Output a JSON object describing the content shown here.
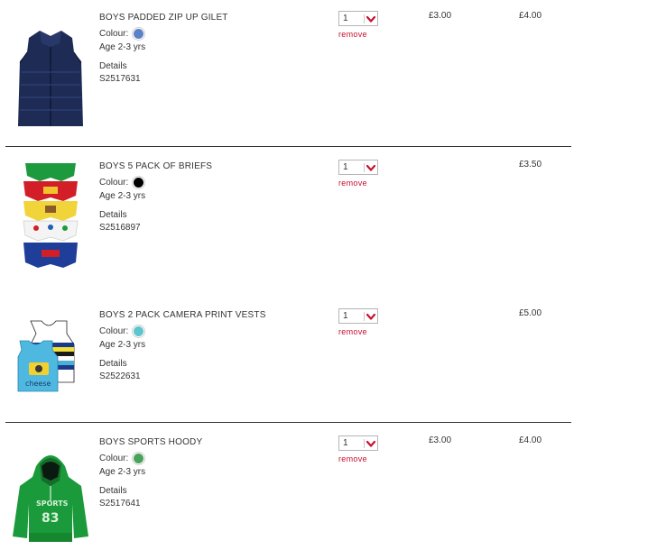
{
  "items": [
    {
      "title": "BOYS PADDED ZIP UP GILET",
      "colour_label": "Colour:",
      "colour_hex": "#5b82c8",
      "size": "Age 2-3 yrs",
      "details_label": "Details",
      "sku": "S2517631",
      "quantity": "1",
      "remove_label": "remove",
      "price_was": "£3.00",
      "price_now": "£4.00",
      "icon": "navy-gilet-icon"
    },
    {
      "title": "BOYS 5 PACK OF BRIEFS",
      "colour_label": "Colour:",
      "colour_hex": "#000000",
      "size": "Age 2-3 yrs",
      "details_label": "Details",
      "sku": "S2516897",
      "quantity": "1",
      "remove_label": "remove",
      "price_was": "",
      "price_now": "£3.50",
      "icon": "briefs-pack-icon"
    },
    {
      "title": "BOYS 2 PACK CAMERA PRINT VESTS",
      "colour_label": "Colour:",
      "colour_hex": "#5ec5cc",
      "size": "Age 2-3 yrs",
      "details_label": "Details",
      "sku": "S2522631",
      "quantity": "1",
      "remove_label": "remove",
      "price_was": "",
      "price_now": "£5.00",
      "icon": "vests-pack-icon"
    },
    {
      "title": "BOYS SPORTS HOODY",
      "colour_label": "Colour:",
      "colour_hex": "#4aa35a",
      "size": "Age 2-3 yrs",
      "details_label": "Details",
      "sku": "S2517641",
      "quantity": "1",
      "remove_label": "remove",
      "price_was": "£3.00",
      "price_now": "£4.00",
      "icon": "green-hoody-icon",
      "print_text": [
        "SPORTS",
        "83"
      ]
    }
  ],
  "colors": {
    "remove": "#c8102e",
    "divider": "#333333",
    "text": "#333333"
  }
}
